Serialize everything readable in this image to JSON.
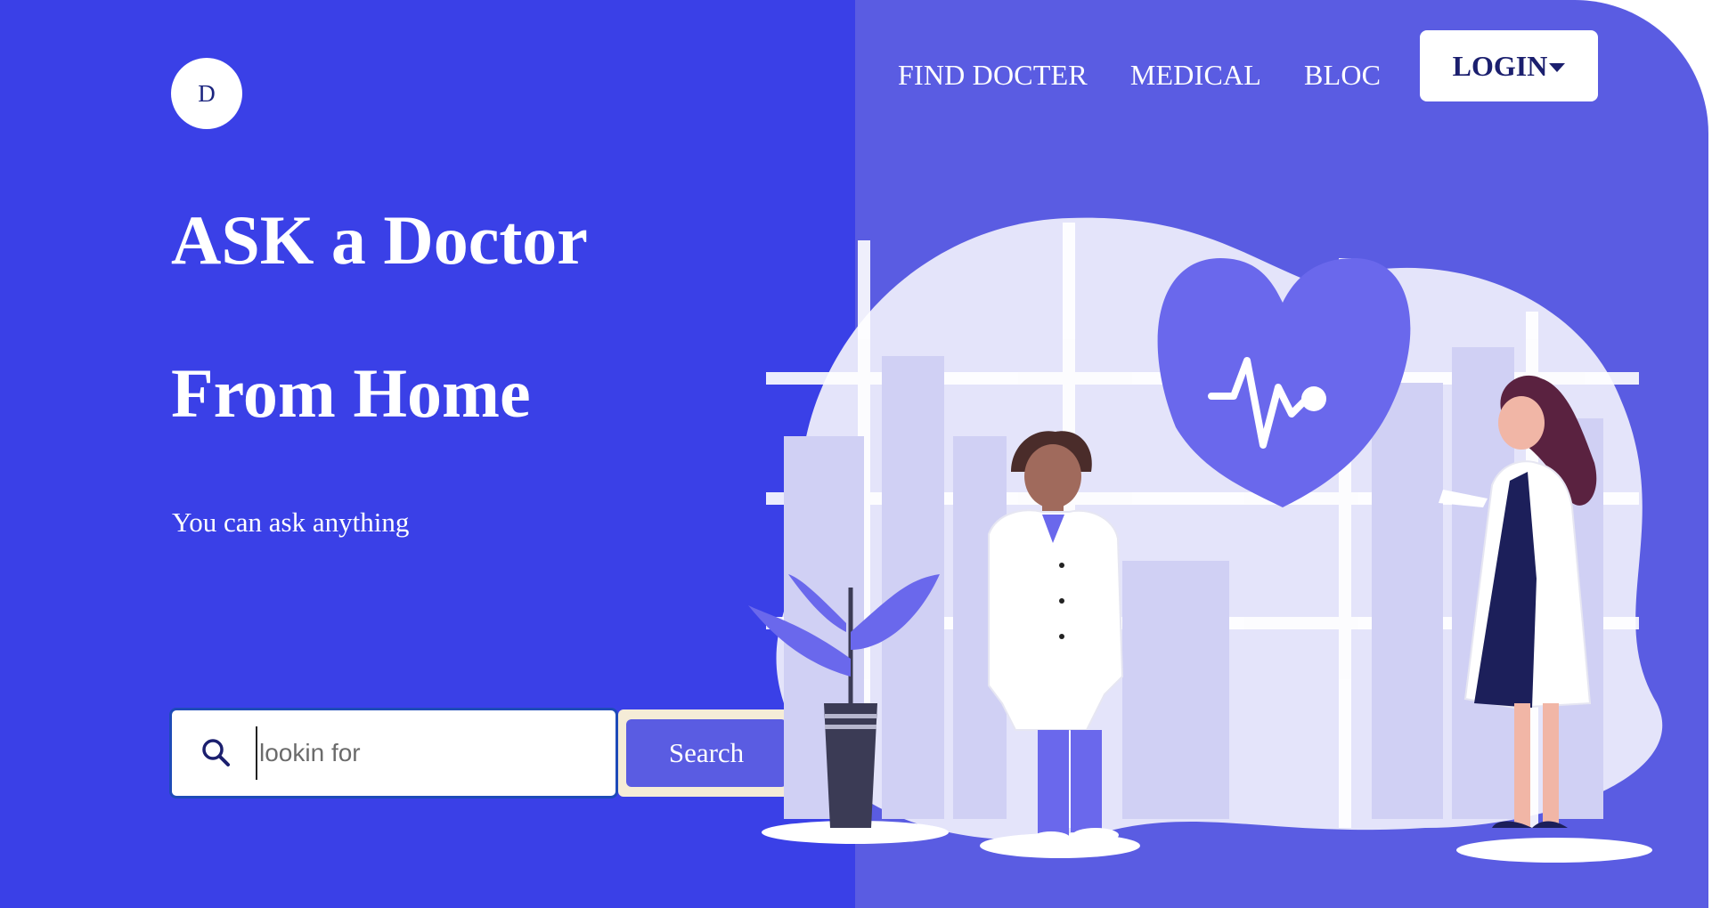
{
  "brand": {
    "logo_letter": "D"
  },
  "nav": {
    "items": [
      {
        "label": "FIND DOCTER"
      },
      {
        "label": "MEDICAL"
      },
      {
        "label": "BLOC"
      }
    ],
    "login_label": "LOGIN"
  },
  "hero": {
    "headline_line1": "ASK a Doctor",
    "headline_line2": "From Home",
    "subtitle": "You can ask anything"
  },
  "search": {
    "placeholder": "lookin for",
    "value": "",
    "button_label": "Search"
  },
  "colors": {
    "left_bg": "#3a40e7",
    "right_bg": "#5a5ce2",
    "accent": "#5a5ce2",
    "text_dark": "#1b1f6e"
  },
  "icons": {
    "search": "search-icon",
    "login_caret": "caret-down-icon",
    "illustration": "doctors-illustration"
  }
}
